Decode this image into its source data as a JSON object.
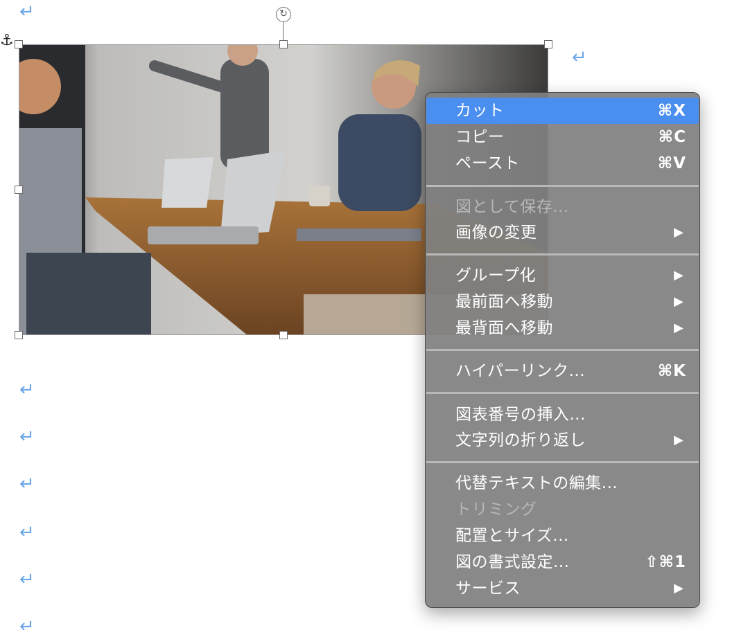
{
  "document": {
    "paragraph_mark": "↵",
    "anchor_icon": "anchor-icon"
  },
  "context_menu": {
    "items": [
      {
        "label": "カット",
        "shortcut": "⌘X",
        "highlighted": true
      },
      {
        "label": "コピー",
        "shortcut": "⌘C"
      },
      {
        "label": "ペースト",
        "shortcut": "⌘V"
      },
      {
        "label": "図として保存...",
        "disabled": true
      },
      {
        "label": "画像の変更",
        "submenu": true
      },
      {
        "label": "グループ化",
        "submenu": true
      },
      {
        "label": "最前面へ移動",
        "submenu": true
      },
      {
        "label": "最背面へ移動",
        "submenu": true
      },
      {
        "label": "ハイパーリンク...",
        "shortcut": "⌘K"
      },
      {
        "label": "図表番号の挿入..."
      },
      {
        "label": "文字列の折り返し",
        "submenu": true
      },
      {
        "label": "代替テキストの編集..."
      },
      {
        "label": "トリミング",
        "disabled": true
      },
      {
        "label": "配置とサイズ..."
      },
      {
        "label": "図の書式設定...",
        "shortcut": "⇧⌘1"
      },
      {
        "label": "サービス",
        "submenu": true
      }
    ],
    "submenu_arrow": "▶"
  },
  "colors": {
    "highlight": "#4a8ef0",
    "paragraph_mark": "#6aa6e8",
    "menu_bg": "#808080"
  }
}
